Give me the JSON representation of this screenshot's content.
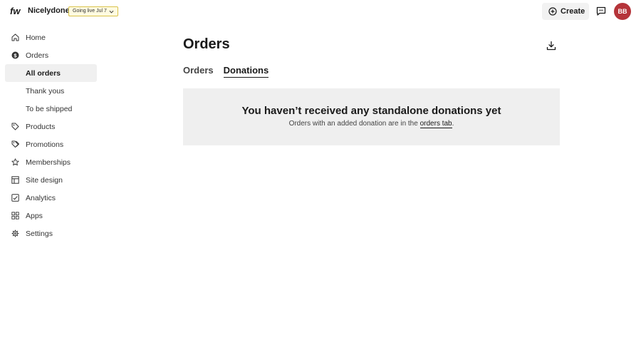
{
  "header": {
    "site_name": "Nicelydone",
    "going_live": "Going live Jul 7",
    "create_label": "Create",
    "avatar_initials": "BB",
    "avatar_color": "#b5343a"
  },
  "sidebar": {
    "items": [
      {
        "label": "Home",
        "icon": "home-icon"
      },
      {
        "label": "Orders",
        "icon": "dollar-circle-icon"
      },
      {
        "label": "All orders",
        "sub": true,
        "active": true
      },
      {
        "label": "Thank yous",
        "sub": true
      },
      {
        "label": "To be shipped",
        "sub": true
      },
      {
        "label": "Products",
        "icon": "tag-icon"
      },
      {
        "label": "Promotions",
        "icon": "tags-icon"
      },
      {
        "label": "Memberships",
        "icon": "star-icon"
      },
      {
        "label": "Site design",
        "icon": "layout-icon"
      },
      {
        "label": "Analytics",
        "icon": "chart-check-icon"
      },
      {
        "label": "Apps",
        "icon": "grid-icon"
      },
      {
        "label": "Settings",
        "icon": "gear-icon"
      }
    ]
  },
  "main": {
    "title": "Orders",
    "tabs": [
      {
        "label": "Orders",
        "selected": false
      },
      {
        "label": "Donations",
        "selected": true
      }
    ],
    "empty": {
      "title": "You haven’t received any standalone donations yet",
      "text_before": "Orders with an added donation are in the ",
      "link": "orders tab",
      "text_after": "."
    }
  }
}
